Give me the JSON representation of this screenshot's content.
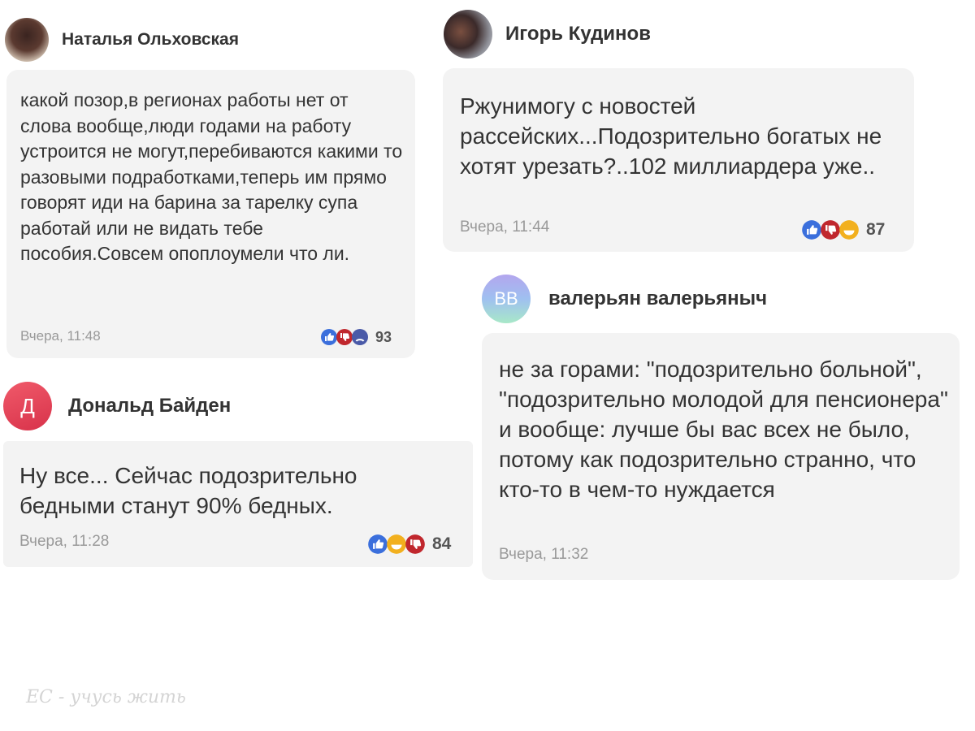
{
  "comments": [
    {
      "author": "Наталья Ольховская",
      "text": "какой позор,в регионах работы нет от слова вообще,люди годами на работу устроится не могут,перебиваются какими то разовыми подработками,теперь им прямо говорят иди на барина за тарелку супа работай или не видать тебе пособия.Совсем опоплоумели что ли.",
      "time": "Вчера, 11:48",
      "reactions": [
        "like-icon",
        "dislike-icon",
        "sad-icon"
      ],
      "reaction_count": "93"
    },
    {
      "author": "Игорь Кудинов",
      "text": "Ржунимогу с новостей рассейских...Подозрительно богатых не хотят урезать?..102 миллиардера уже..",
      "time": "Вчера, 11:44",
      "reactions": [
        "like-icon",
        "dislike-icon",
        "laugh-icon"
      ],
      "reaction_count": "87"
    },
    {
      "author": "Дональд Байден",
      "avatar_letter": "Д",
      "text": "Ну все... Сейчас подозрительно бедными станут 90% бедных.",
      "time": "Вчера, 11:28",
      "reactions": [
        "like-icon",
        "laugh-icon",
        "dislike-icon"
      ],
      "reaction_count": "84"
    },
    {
      "author": "валерьян валерьяныч",
      "avatar_letter": "ВВ",
      "text": "не за горами: \"подозрительно больной\", \"подозрительно молодой для пенсионера\" и вообще: лучше бы вас всех не было, потому как подозрительно странно, что кто-то в чем-то нуждается",
      "time": "Вчера, 11:32"
    }
  ],
  "watermark": "ЕС - учусь жить",
  "colors": {
    "like": "#3b6fdc",
    "dislike": "#c0272d",
    "laugh": "#f2b01e",
    "sad": "#4a5aa8",
    "bubble": "#f3f3f3",
    "avatar_d": "#e8445a",
    "avatar_vv": "#a9b8f0"
  }
}
